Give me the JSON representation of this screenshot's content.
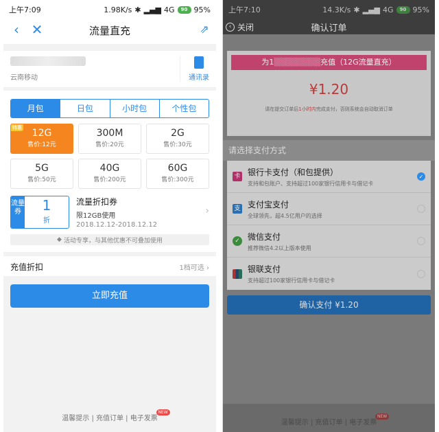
{
  "left": {
    "status": {
      "time": "上午7:09",
      "speed": "1.98K/s",
      "net": "4G",
      "battery": "95%",
      "batt_icon": "90"
    },
    "nav": {
      "title": "流量直充"
    },
    "account": {
      "carrier": "云南移动",
      "contacts_label": "通讯录"
    },
    "tabs": [
      "月包",
      "日包",
      "小时包",
      "个性包"
    ],
    "packages": [
      {
        "size": "12G",
        "price": "售价:12元",
        "badge": "特惠"
      },
      {
        "size": "300M",
        "price": "售价:20元"
      },
      {
        "size": "2G",
        "price": "售价:30元"
      },
      {
        "size": "5G",
        "price": "售价:50元"
      },
      {
        "size": "40G",
        "price": "售价:200元"
      },
      {
        "size": "60G",
        "price": "售价:300元"
      }
    ],
    "coupon": {
      "tag": "流量券",
      "num": "1",
      "unit": "折",
      "title": "流量折扣券",
      "limit": "限12GB使用",
      "dates": "2018.12.12-2018.12.12"
    },
    "note": "活动专享，与其他优惠不可叠加使用",
    "discount": {
      "label": "充值折扣",
      "value": "1档可选"
    },
    "button": "立即充值",
    "footer": {
      "a": "温馨提示",
      "b": "充值订单",
      "c": "电子发票",
      "new": "NEW"
    }
  },
  "right": {
    "status": {
      "time": "上午7:10",
      "speed": "14.3K/s",
      "net": "4G",
      "battery": "95%",
      "batt_icon": "90"
    },
    "nav": {
      "back": "关闭",
      "title": "确认订单"
    },
    "order": {
      "banner_pre": "为1",
      "banner_post": "充值（12G流量直充）",
      "price": "¥1.20",
      "hint_a": "请在提交订单后",
      "hint_b": "1小时内",
      "hint_c": "完成支付，否则系统会自动取消订单"
    },
    "pay_header": "请选择支付方式",
    "methods": [
      {
        "name": "银行卡支付（和包提供）",
        "desc": "支持和包账户、支持超过100家银行信用卡与借记卡",
        "selected": true
      },
      {
        "name": "支付宝支付",
        "desc": "全球领先，超4.5亿用户的选择",
        "selected": false
      },
      {
        "name": "微信支付",
        "desc": "推荐微信4.2以上版本使用",
        "selected": false
      },
      {
        "name": "银联支付",
        "desc": "支持超过100家银行信用卡与借记卡",
        "selected": false
      }
    ],
    "button": "确认支付 ¥1.20",
    "footer": {
      "a": "温馨提示",
      "b": "充值订单",
      "c": "电子发票",
      "new": "NEW"
    }
  }
}
